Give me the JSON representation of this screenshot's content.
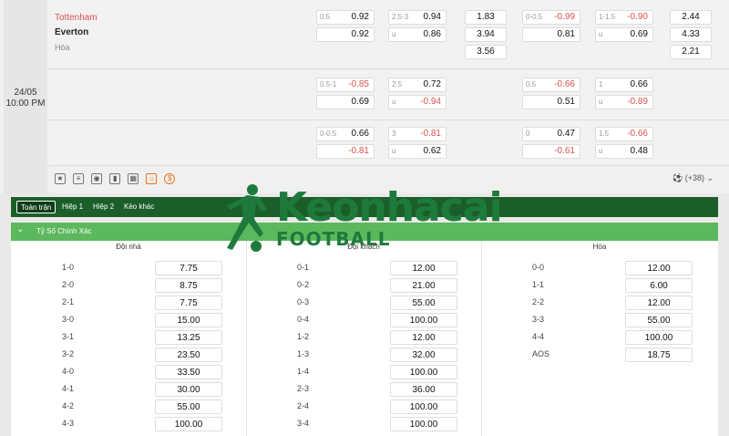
{
  "match": {
    "date": "24/05",
    "time": "10:00 PM",
    "home": "Tottenham",
    "away": "Everton",
    "draw": "Hòa"
  },
  "market_rows": [
    {
      "a1": {
        "h": "0.5",
        "v1": "0.92",
        "v2": "0.92"
      },
      "a2": {
        "h": "2.5-3",
        "v1": "0.94",
        "u": "u",
        "v2": "0.86"
      },
      "w": [
        "1.83",
        "3.94",
        "3.56"
      ],
      "b1": {
        "h": "0-0.5",
        "v1": "-0.99",
        "v2": "0.81"
      },
      "b2": {
        "h": "1-1.5",
        "v1": "-0.90",
        "u": "u",
        "v2": "0.69"
      },
      "w2": [
        "2.44",
        "4.33",
        "2.21"
      ]
    },
    {
      "a1": {
        "h": "0.5-1",
        "v1": "-0.85",
        "v2": "0.69"
      },
      "a2": {
        "h": "2.5",
        "v1": "0.72",
        "u": "u",
        "v2": "-0.94"
      },
      "b1": {
        "h": "0.5",
        "v1": "-0.66",
        "v2": "0.51"
      },
      "b2": {
        "h": "1",
        "v1": "0.66",
        "u": "u",
        "v2": "-0.89"
      }
    },
    {
      "a1": {
        "h": "0-0.5",
        "v1": "0.66",
        "v2": "-0.81"
      },
      "a2": {
        "h": "3",
        "v1": "-0.81",
        "u": "u",
        "v2": "0.62"
      },
      "b1": {
        "h": "0",
        "v1": "0.47",
        "v2": "-0.61"
      },
      "b2": {
        "h": "1.5",
        "v1": "-0.66",
        "u": "u",
        "v2": "0.48"
      }
    }
  ],
  "more_markets": "(+38)",
  "icons": [
    "star-icon",
    "database-icon",
    "eye-icon",
    "bar-chart-icon",
    "table-icon",
    "fire-icon",
    "badge-icon"
  ],
  "tabs": [
    "Toàn trận",
    "Hiệp 1",
    "Hiệp 2",
    "Kèo khác"
  ],
  "section_title": "Tỷ Số Chính Xác",
  "columns": {
    "home": {
      "label": "Đội nhà",
      "rows": [
        [
          "1-0",
          "7.75"
        ],
        [
          "2-0",
          "8.75"
        ],
        [
          "2-1",
          "7.75"
        ],
        [
          "3-0",
          "15.00"
        ],
        [
          "3-1",
          "13.25"
        ],
        [
          "3-2",
          "23.50"
        ],
        [
          "4-0",
          "33.50"
        ],
        [
          "4-1",
          "30.00"
        ],
        [
          "4-2",
          "55.00"
        ],
        [
          "4-3",
          "100.00"
        ]
      ]
    },
    "away": {
      "label": "Đội khách",
      "rows": [
        [
          "0-1",
          "12.00"
        ],
        [
          "0-2",
          "21.00"
        ],
        [
          "0-3",
          "55.00"
        ],
        [
          "0-4",
          "100.00"
        ],
        [
          "1-2",
          "12.00"
        ],
        [
          "1-3",
          "32.00"
        ],
        [
          "1-4",
          "100.00"
        ],
        [
          "2-3",
          "36.00"
        ],
        [
          "2-4",
          "100.00"
        ],
        [
          "3-4",
          "100.00"
        ]
      ]
    },
    "draw": {
      "label": "Hòa",
      "rows": [
        [
          "0-0",
          "12.00"
        ],
        [
          "1-1",
          "6.00"
        ],
        [
          "2-2",
          "12.00"
        ],
        [
          "3-3",
          "55.00"
        ],
        [
          "4-4",
          "100.00"
        ],
        [
          "AOS",
          "18.75"
        ]
      ]
    }
  },
  "watermark": {
    "main": "Keonhacai",
    "sub": "FOOTBALL"
  },
  "colors": {
    "accent": "#1b5e2a",
    "section": "#5cb85c",
    "negative": "#d9534f"
  }
}
